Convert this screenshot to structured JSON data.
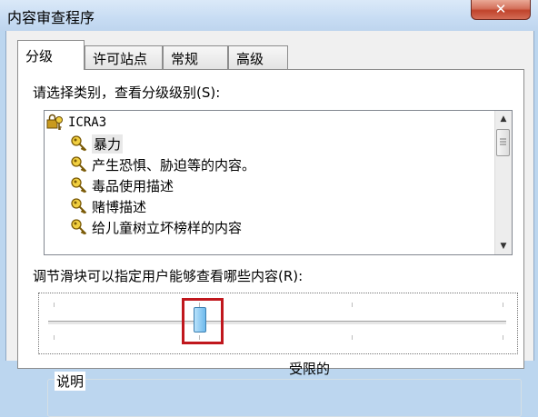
{
  "window": {
    "title": "内容审查程序",
    "close_glyph": "✕"
  },
  "tabs": [
    {
      "label": "分级",
      "active": true
    },
    {
      "label": "许可站点",
      "active": false
    },
    {
      "label": "常规",
      "active": false
    },
    {
      "label": "高级",
      "active": false
    }
  ],
  "category_label": "请选择类别，查看分级级别(S):",
  "categories": {
    "root": {
      "label": "ICRA3",
      "icon": "key-lock-icon"
    },
    "items": [
      {
        "label": "暴力",
        "icon": "key-icon",
        "selected": true
      },
      {
        "label": "产生恐惧、胁迫等的内容。",
        "icon": "key-icon"
      },
      {
        "label": "毒品使用描述",
        "icon": "key-icon"
      },
      {
        "label": "赌博描述",
        "icon": "key-icon"
      },
      {
        "label": "给儿童树立坏榜样的内容",
        "icon": "key-icon"
      }
    ]
  },
  "slider_label": "调节滑块可以指定用户能够查看哪些内容(R):",
  "slider": {
    "level_label": "受限的",
    "accent": "#c0171d"
  },
  "description": {
    "title": "说明"
  }
}
